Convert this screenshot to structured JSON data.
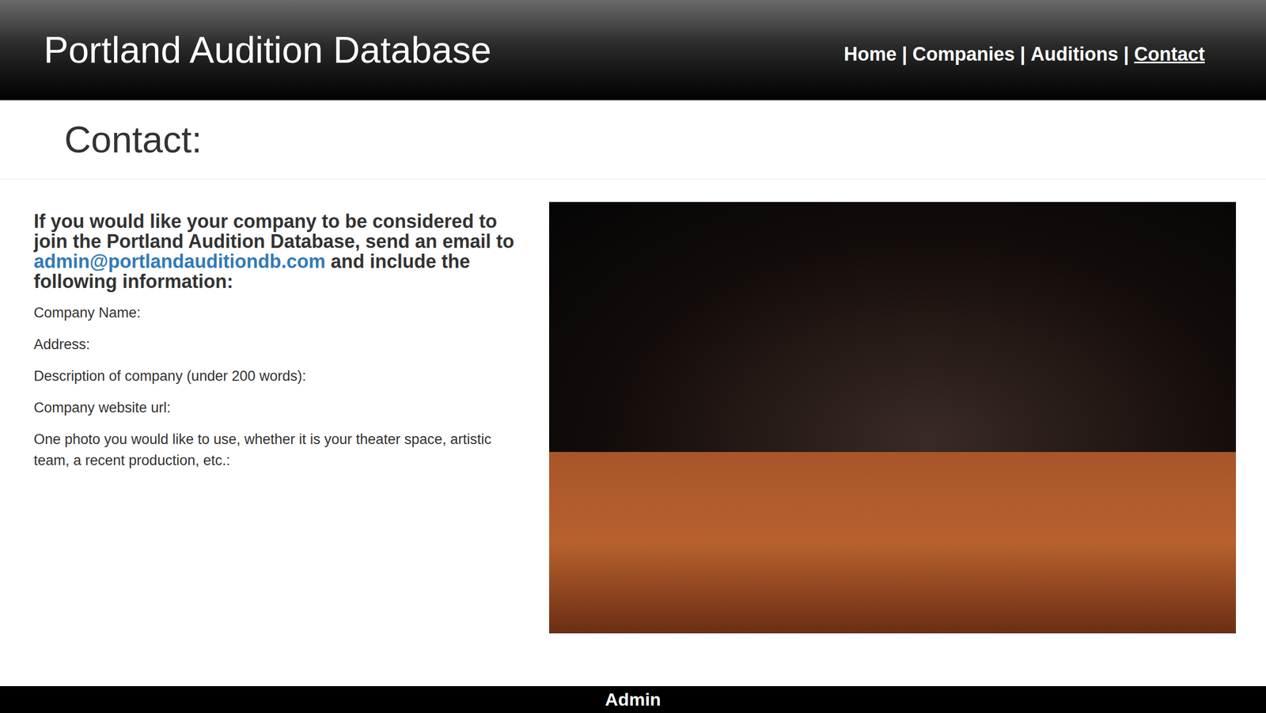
{
  "window": {
    "title": "Portland Audition Database"
  },
  "nav": {
    "separator": "|",
    "items": [
      {
        "label": "Home",
        "selected": false
      },
      {
        "label": "Companies",
        "selected": false
      },
      {
        "label": "Auditions",
        "selected": false
      },
      {
        "label": "Contact",
        "selected": true
      }
    ]
  },
  "page": {
    "heading": "Contact:"
  },
  "intro": {
    "before": "If you would like your company to be considered to join the Portland Audition Database, send an email to ",
    "email": "admin@portlandauditiondb.com",
    "after": " and include the following information:"
  },
  "fields": [
    "Company Name:",
    "Address:",
    "Description of company (under 200 words):",
    "Company website url:",
    "One photo you would like to use, whether it is your theater space, artistic team, a recent production, etc.:"
  ],
  "footer": {
    "label": "Admin"
  }
}
